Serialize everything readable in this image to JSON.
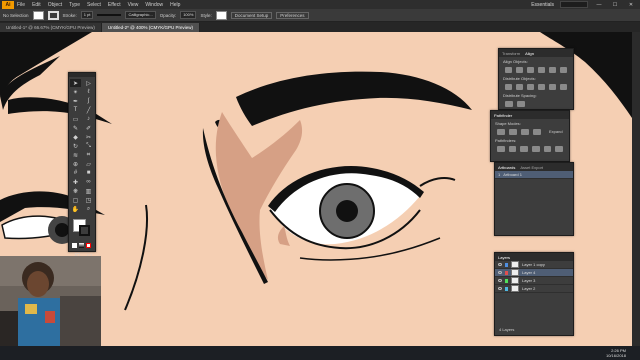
{
  "app": {
    "logo": "Ai",
    "workspace": "Essentials"
  },
  "menu": [
    "File",
    "Edit",
    "Object",
    "Type",
    "Select",
    "Effect",
    "View",
    "Window",
    "Help"
  ],
  "window_buttons": [
    "—",
    "☐",
    "✕"
  ],
  "control_bar": {
    "selection_label": "No Selection",
    "stroke_label": "Stroke:",
    "stroke_value": "1 pt",
    "brush_label": "Calligraphic...",
    "opacity_label": "Opacity:",
    "opacity_value": "100%",
    "style_label": "Style:",
    "doc_setup": "Document Setup",
    "preferences": "Preferences"
  },
  "tabs": [
    {
      "label": "Untitled-1* @ 66.67% (CMYK/GPU Preview)",
      "active": false
    },
    {
      "label": "Untitled-2* @ 400% (CMYK/GPU Preview)",
      "active": true
    }
  ],
  "align_panel": {
    "tabs": [
      "Transform",
      "Align"
    ],
    "active": "Align",
    "section1": "Align Objects:",
    "section2": "Distribute Objects:",
    "section3": "Distribute Spacing:"
  },
  "pathfinder_panel": {
    "title": "Pathfinder",
    "section1": "Shape Modes:",
    "section2": "Pathfinders:",
    "expand": "Expand"
  },
  "artboards_panel": {
    "tabs": [
      "Artboards",
      "Asset Export"
    ],
    "items": [
      {
        "num": "1",
        "name": "Artboard 1"
      }
    ]
  },
  "layers_panel": {
    "title": "Layers",
    "layers": [
      {
        "name": "Layer 1 copy",
        "color": "#4f8fe0",
        "selected": false
      },
      {
        "name": "Layer 4",
        "color": "#e04f4f",
        "selected": true
      },
      {
        "name": "Layer 3",
        "color": "#4fe05a",
        "selected": false
      },
      {
        "name": "Layer 2",
        "color": "#4fb8e0",
        "selected": false
      }
    ],
    "footer": "4 Layers"
  },
  "taskbar": {
    "time": "2:26 PM",
    "date": "10/16/2018"
  },
  "tool_icons": [
    "selection-icon",
    "direct-selection-icon",
    "magic-wand-icon",
    "lasso-icon",
    "pen-icon",
    "curvature-icon",
    "type-icon",
    "line-icon",
    "rectangle-icon",
    "paintbrush-icon",
    "shaper-icon",
    "pencil-icon",
    "eraser-icon",
    "scissors-icon",
    "rotate-icon",
    "scale-icon",
    "width-icon",
    "free-transform-icon",
    "shape-builder-icon",
    "perspective-icon",
    "mesh-icon",
    "gradient-icon",
    "eyedropper-icon",
    "blend-icon",
    "symbol-sprayer-icon",
    "graph-icon",
    "artboard-icon",
    "slice-icon",
    "hand-icon",
    "zoom-icon"
  ],
  "tool_glyphs": [
    "➤",
    "▷",
    "✴",
    "ℓ",
    "✒",
    "∫",
    "T",
    "╱",
    "▭",
    "♪",
    "✎",
    "✐",
    "◆",
    "✂",
    "↻",
    "⤡",
    "≋",
    "⌗",
    "⊕",
    "▱",
    "#",
    "■",
    "✚",
    "∞",
    "❋",
    "▥",
    "▢",
    "◳",
    "✋",
    "⌕"
  ]
}
